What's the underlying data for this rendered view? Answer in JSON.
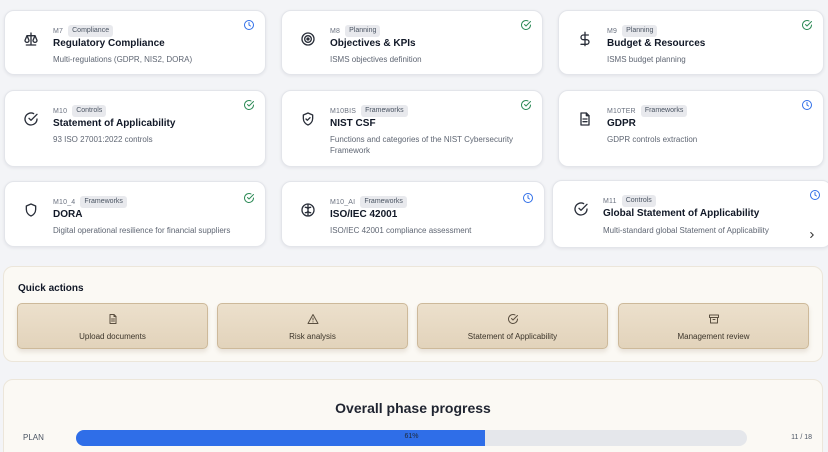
{
  "modules": [
    {
      "code": "M7",
      "tag": "Compliance",
      "title": "Regulatory Compliance",
      "desc": "Multi-regulations (GDPR, NIS2, DORA)",
      "icon": "scale-icon",
      "status": "pending"
    },
    {
      "code": "M8",
      "tag": "Planning",
      "title": "Objectives & KPIs",
      "desc": "ISMS objectives definition",
      "icon": "target-icon",
      "status": "done"
    },
    {
      "code": "M9",
      "tag": "Planning",
      "title": "Budget & Resources",
      "desc": "ISMS budget planning",
      "icon": "dollar-icon",
      "status": "done"
    },
    {
      "code": "M10",
      "tag": "Controls",
      "title": "Statement of Applicability",
      "desc": "93 ISO 27001:2022 controls",
      "icon": "check-circle-icon",
      "status": "done"
    },
    {
      "code": "M10BIS",
      "tag": "Frameworks",
      "title": "NIST CSF",
      "desc": "Functions and categories of the NIST Cybersecurity Framework",
      "icon": "shield-check-icon",
      "status": "done"
    },
    {
      "code": "M10TER",
      "tag": "Frameworks",
      "title": "GDPR",
      "desc": "GDPR controls extraction",
      "icon": "document-icon",
      "status": "pending"
    },
    {
      "code": "M10_4",
      "tag": "Frameworks",
      "title": "DORA",
      "desc": "Digital operational resilience for financial suppliers",
      "icon": "shield-icon",
      "status": "done"
    },
    {
      "code": "M10_AI",
      "tag": "Frameworks",
      "title": "ISO/IEC 42001",
      "desc": "ISO/IEC 42001 compliance assessment",
      "icon": "brain-icon",
      "status": "pending"
    },
    {
      "code": "M11",
      "tag": "Controls",
      "title": "Global Statement of Applicability",
      "desc": "Multi-standard global Statement of Applicability",
      "icon": "check-circle-icon",
      "status": "pending"
    }
  ],
  "quick_actions": {
    "title": "Quick actions",
    "items": [
      {
        "label": "Upload documents",
        "icon": "file-icon"
      },
      {
        "label": "Risk analysis",
        "icon": "warning-icon"
      },
      {
        "label": "Statement of Applicability",
        "icon": "check-circle-icon"
      },
      {
        "label": "Management review",
        "icon": "archive-icon"
      }
    ]
  },
  "progress": {
    "title": "Overall phase progress",
    "phase": "PLAN",
    "percent_label": "61%",
    "percent": 61,
    "count": "11 / 18"
  },
  "colors": {
    "done": "#2e8b57",
    "pending": "#2f6ee8",
    "progress_fill": "#2f6ee8"
  }
}
